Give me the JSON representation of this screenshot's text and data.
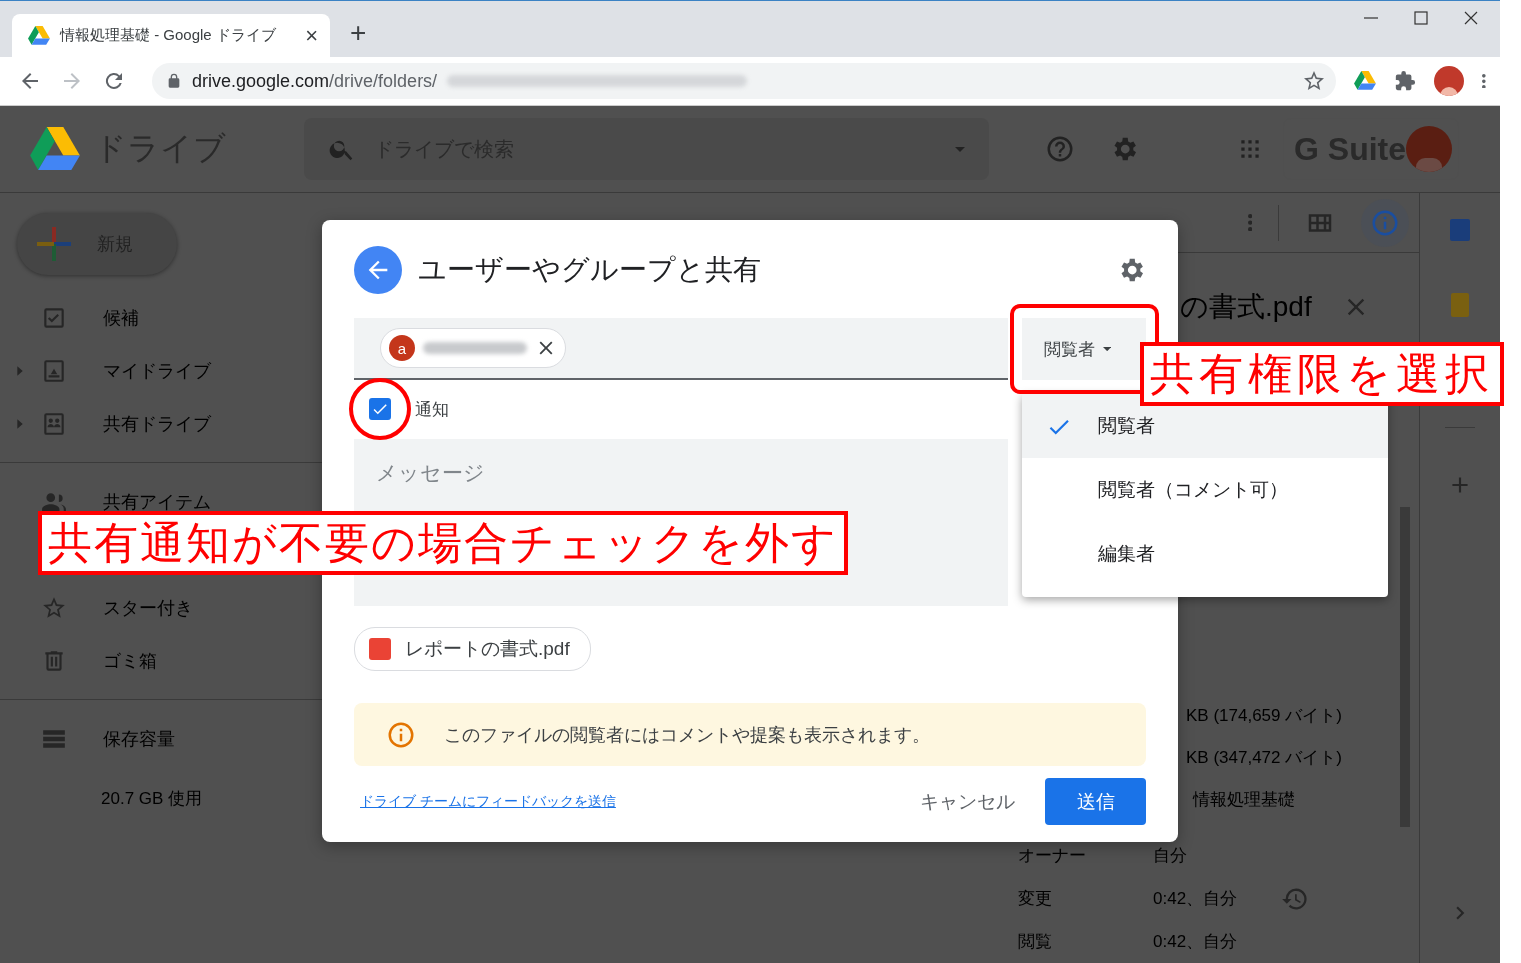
{
  "browser": {
    "tab": {
      "title": "情報処理基礎 - Google ドライブ",
      "close": "×"
    },
    "new_tab": "+",
    "url": {
      "host": "drive.google.com",
      "path": "/drive/folders/"
    }
  },
  "drive": {
    "app_name": "ドライブ",
    "search": {
      "placeholder": "ドライブで検索"
    },
    "brand": "G Suite",
    "new_button": "新規",
    "sidebar": {
      "sections": [
        [
          {
            "label": "候補",
            "expandable": false
          },
          {
            "label": "マイドライブ",
            "expandable": true
          },
          {
            "label": "共有ドライブ",
            "expandable": true
          }
        ],
        [
          {
            "label": "共有アイテム",
            "expandable": false
          },
          {
            "label": "スター付き",
            "expandable": false
          },
          {
            "label": "ゴミ箱",
            "expandable": false
          }
        ]
      ],
      "storage": {
        "label": "保存容量",
        "usage": "20.7 GB 使用"
      }
    },
    "details": {
      "title": "の書式.pdf",
      "sizes": [
        "KB (174,659 バイト)",
        "KB (347,472 バイト)"
      ],
      "folder": "情報処理基礎",
      "rows": [
        {
          "label": "オーナー",
          "value": "自分"
        },
        {
          "label": "変更",
          "value": "0:42、自分"
        },
        {
          "label": "閲覧",
          "value": "0:42、自分"
        }
      ]
    }
  },
  "dialog": {
    "title": "ユーザーやグループと共有",
    "chip_avatar": "a",
    "role": "閲覧者",
    "notify": {
      "label": "通知",
      "checked": true
    },
    "message": {
      "placeholder": "メッセージ"
    },
    "file": "レポートの書式.pdf",
    "notice": "このファイルの閲覧者にはコメントや提案も表示されます。",
    "feedback_link": "ドライブ チームにフィードバックを送信",
    "cancel": "キャンセル",
    "send": "送信"
  },
  "menu": {
    "items": [
      {
        "label": "閲覧者",
        "selected": true
      },
      {
        "label": "閲覧者（コメント可）",
        "selected": false
      },
      {
        "label": "編集者",
        "selected": false
      }
    ]
  },
  "annotations": [
    {
      "text": "共有通知が不要の場合チェックを外す"
    },
    {
      "text": "共有権限を選択"
    }
  ]
}
